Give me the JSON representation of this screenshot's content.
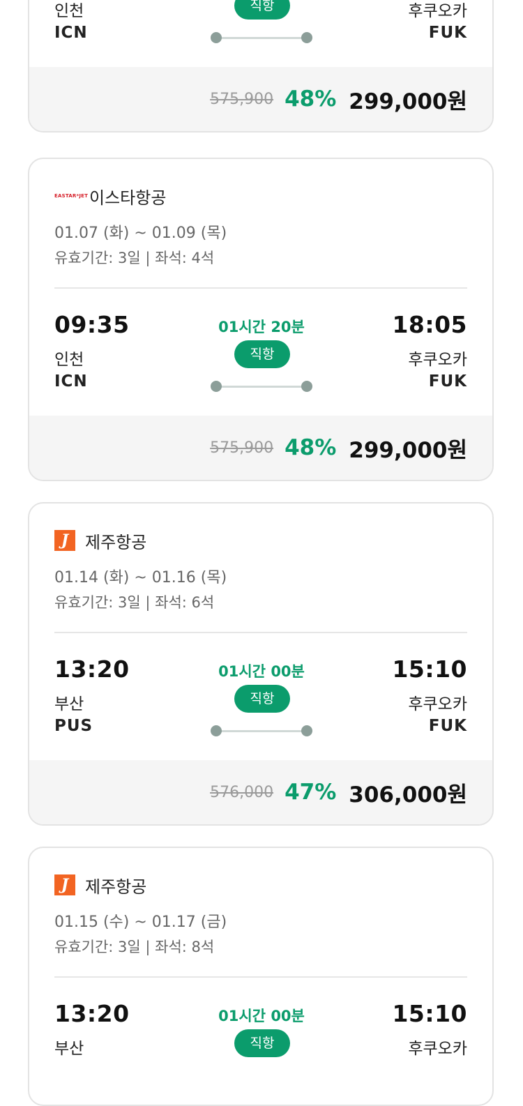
{
  "cards": [
    {
      "airline": {
        "name": "",
        "logo": ""
      },
      "dates": "",
      "validity": "",
      "depart": {
        "time": "",
        "city": "인천",
        "code": "ICN"
      },
      "arrive": {
        "time": "",
        "city": "후쿠오카",
        "code": "FUK"
      },
      "duration": "",
      "flight_type": "직항",
      "price": {
        "original": "575,900",
        "discount": "48%",
        "final": "299,000원"
      }
    },
    {
      "airline": {
        "name": "이스타항공",
        "logo": "EASTAR*JET"
      },
      "dates": "01.07 (화) ~ 01.09 (목)",
      "validity": "유효기간: 3일 | 좌석: 4석",
      "depart": {
        "time": "09:35",
        "city": "인천",
        "code": "ICN"
      },
      "arrive": {
        "time": "18:05",
        "city": "후쿠오카",
        "code": "FUK"
      },
      "duration": "01시간 20분",
      "flight_type": "직항",
      "price": {
        "original": "575,900",
        "discount": "48%",
        "final": "299,000원"
      }
    },
    {
      "airline": {
        "name": "제주항공",
        "logo": "J"
      },
      "dates": "01.14 (화) ~ 01.16 (목)",
      "validity": "유효기간: 3일 | 좌석: 6석",
      "depart": {
        "time": "13:20",
        "city": "부산",
        "code": "PUS"
      },
      "arrive": {
        "time": "15:10",
        "city": "후쿠오카",
        "code": "FUK"
      },
      "duration": "01시간 00분",
      "flight_type": "직항",
      "price": {
        "original": "576,000",
        "discount": "47%",
        "final": "306,000원"
      }
    },
    {
      "airline": {
        "name": "제주항공",
        "logo": "J"
      },
      "dates": "01.15 (수) ~ 01.17 (금)",
      "validity": "유효기간: 3일 | 좌석: 8석",
      "depart": {
        "time": "13:20",
        "city": "부산",
        "code": ""
      },
      "arrive": {
        "time": "15:10",
        "city": "후쿠오카",
        "code": ""
      },
      "duration": "01시간 00분",
      "flight_type": "직항"
    }
  ],
  "colors": {
    "accent": "#0b9c6c",
    "route_dot": "#8c9e99",
    "price_bar_bg": "#f5f5f5",
    "card_border": "#e3e3e3",
    "eastar_red": "#d6202a",
    "jeju_orange": "#f26422"
  }
}
